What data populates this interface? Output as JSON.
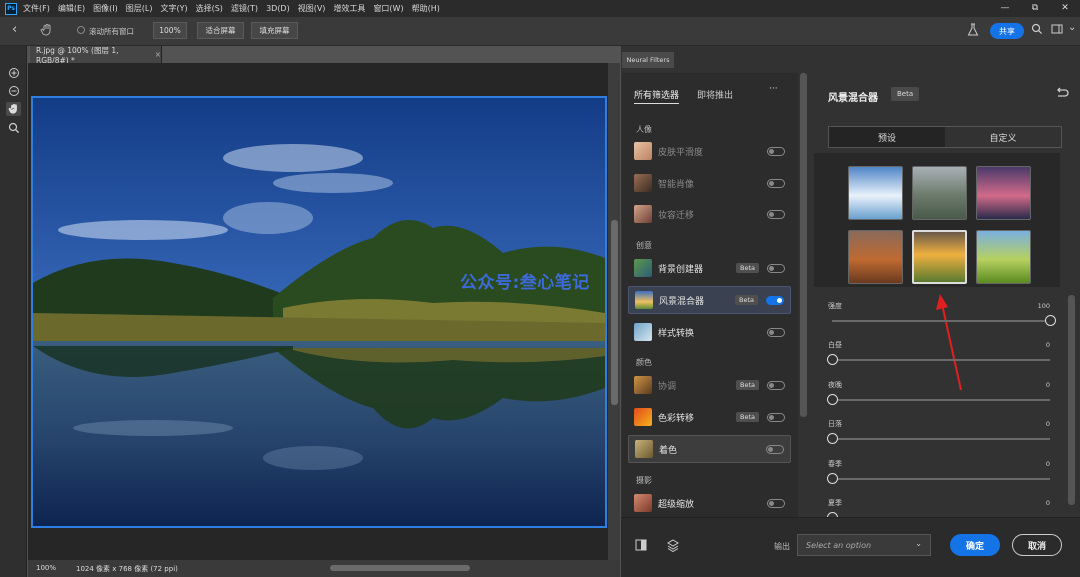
{
  "menubar": {
    "logo": "Ps",
    "items": [
      "文件(F)",
      "编辑(E)",
      "图像(I)",
      "图层(L)",
      "文字(Y)",
      "选择(S)",
      "滤镜(T)",
      "3D(D)",
      "视图(V)",
      "增效工具",
      "窗口(W)",
      "帮助(H)"
    ],
    "window_controls": [
      "—",
      "⧉",
      "✕"
    ]
  },
  "options": {
    "scroll_all": "滚动所有窗口",
    "zoom": "100%",
    "fit_screen": "适合屏幕",
    "fill_screen": "填充屏幕",
    "share": "共享"
  },
  "document": {
    "tab": "R.jpg @ 100% (图层 1, RGB/8#) *",
    "status_zoom": "100%",
    "status_info": "1024 像素 x 768 像素 (72 ppi)",
    "watermark": "公众号:叁心笔记"
  },
  "neural": {
    "panel_tab": "Neural Filters",
    "tab_all": "所有筛选器",
    "tab_soon": "即将推出",
    "more": "···",
    "categories": {
      "portrait": "人像",
      "creative": "创意",
      "color": "颜色",
      "photo": "摄影"
    },
    "filters": [
      {
        "name": "皮肤平滑度",
        "beta": ""
      },
      {
        "name": "智能肖像",
        "beta": ""
      },
      {
        "name": "妆容迁移",
        "beta": ""
      },
      {
        "name": "背景创建器",
        "beta": "Beta"
      },
      {
        "name": "风景混合器",
        "beta": "Beta"
      },
      {
        "name": "样式转换",
        "beta": ""
      },
      {
        "name": "协调",
        "beta": "Beta"
      },
      {
        "name": "色彩转移",
        "beta": "Beta"
      },
      {
        "name": "着色",
        "beta": ""
      },
      {
        "name": "超级缩放",
        "beta": ""
      }
    ],
    "filter_enabled": [
      false,
      false,
      false,
      false,
      true,
      false,
      false,
      false,
      false,
      false
    ],
    "detail": {
      "title": "风景混合器",
      "beta": "Beta",
      "tab_presets": "预设",
      "tab_custom": "自定义",
      "sliders": [
        {
          "label": "强度",
          "value": "100",
          "fraction": 1.0
        },
        {
          "label": "白昼",
          "value": "0",
          "fraction": 0
        },
        {
          "label": "夜晚",
          "value": "0",
          "fraction": 0
        },
        {
          "label": "日落",
          "value": "0",
          "fraction": 0
        },
        {
          "label": "春季",
          "value": "0",
          "fraction": 0
        },
        {
          "label": "夏季",
          "value": "0",
          "fraction": 0
        }
      ]
    },
    "output_label": "输出",
    "output_placeholder": "Select an option",
    "ok": "确定",
    "cancel": "取消"
  },
  "colors": {
    "accent": "#1473e6",
    "selection_border": "#2f7fe3",
    "arrow": "#e02020"
  }
}
